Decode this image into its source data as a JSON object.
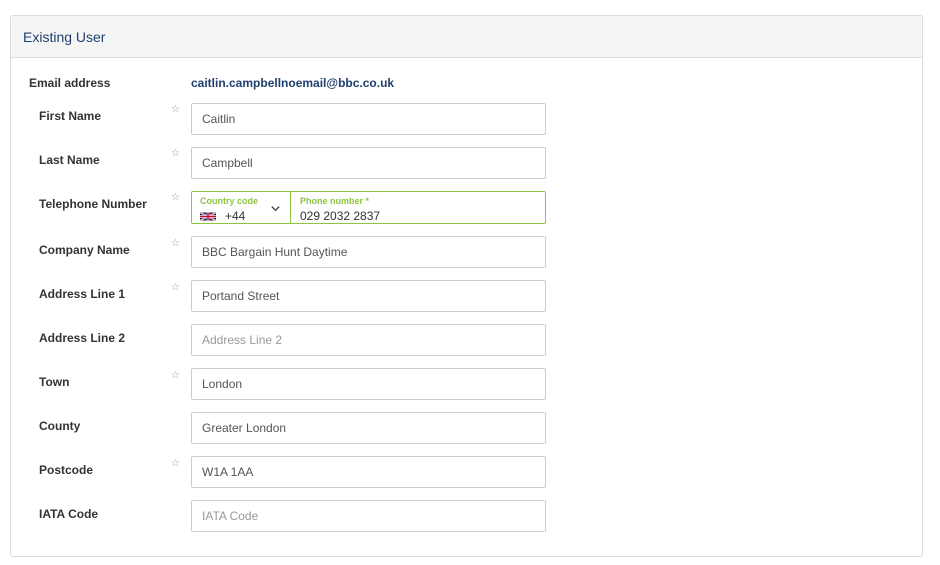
{
  "panel": {
    "title": "Existing User"
  },
  "form": {
    "email": {
      "label": "Email address",
      "value": "caitlin.campbellnoemail@bbc.co.uk"
    },
    "first_name": {
      "label": "First Name",
      "required": "☆",
      "value": "Caitlin",
      "placeholder": ""
    },
    "last_name": {
      "label": "Last Name",
      "required": "☆",
      "value": "Campbell",
      "placeholder": ""
    },
    "telephone": {
      "label": "Telephone Number",
      "required": "☆",
      "country_code_label": "Country code",
      "country_code_value": "+44",
      "country_flag": "uk-flag-icon",
      "phone_label": "Phone number *",
      "phone_value": "029 2032 2837"
    },
    "company_name": {
      "label": "Company Name",
      "required": "☆",
      "value": "BBC Bargain Hunt Daytime",
      "placeholder": ""
    },
    "address_line_1": {
      "label": "Address Line 1",
      "required": "☆",
      "value": "Portand Street",
      "placeholder": ""
    },
    "address_line_2": {
      "label": "Address Line 2",
      "value": "",
      "placeholder": "Address Line 2"
    },
    "town": {
      "label": "Town",
      "required": "☆",
      "value": "London",
      "placeholder": ""
    },
    "county": {
      "label": "County",
      "value": "Greater London",
      "placeholder": ""
    },
    "postcode": {
      "label": "Postcode",
      "required": "☆",
      "value": "W1A 1AA",
      "placeholder": ""
    },
    "iata_code": {
      "label": "IATA Code",
      "value": "",
      "placeholder": "IATA Code"
    }
  },
  "colors": {
    "accent_green": "#8cc63f",
    "title_blue": "#1f3f6e"
  }
}
